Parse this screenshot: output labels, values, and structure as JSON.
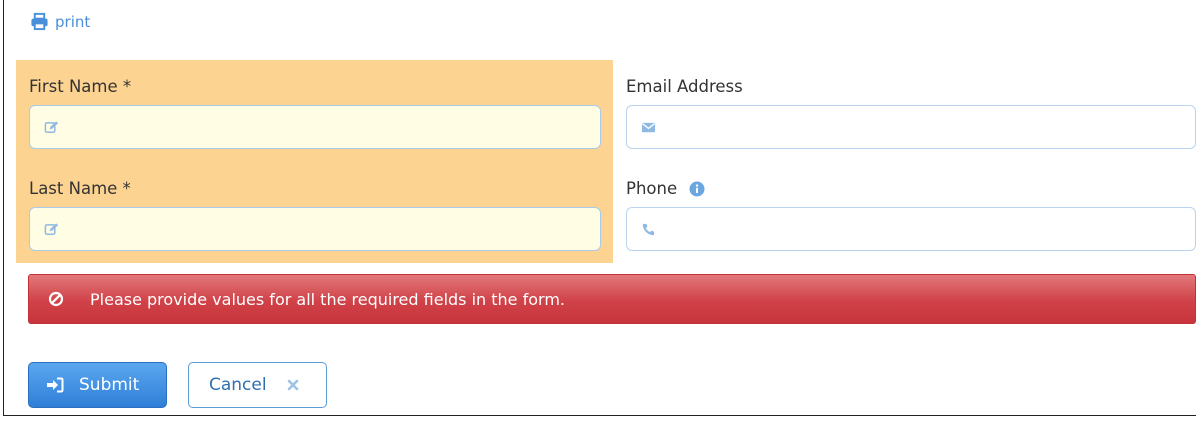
{
  "toolbar": {
    "print_label": "print",
    "print_icon": "printer-icon"
  },
  "form": {
    "first_name": {
      "label": "First Name *",
      "value": "",
      "icon": "edit-icon",
      "required": true
    },
    "last_name": {
      "label": "Last Name *",
      "value": "",
      "icon": "edit-icon",
      "required": true
    },
    "email": {
      "label": "Email Address",
      "value": "",
      "icon": "envelope-icon",
      "required": false
    },
    "phone": {
      "label": "Phone",
      "value": "",
      "icon": "phone-icon",
      "info_icon": "info-icon",
      "required": false
    }
  },
  "alert": {
    "icon": "ban-icon",
    "message": "Please provide values for all the required fields in the form."
  },
  "buttons": {
    "submit_label": "Submit",
    "cancel_label": "Cancel"
  },
  "colors": {
    "accent": "#4a90d9",
    "required_highlight": "#fdd392",
    "required_input_bg": "#fffde3",
    "alert_red": "#d04148",
    "submit_blue": "#2f7fd8"
  }
}
